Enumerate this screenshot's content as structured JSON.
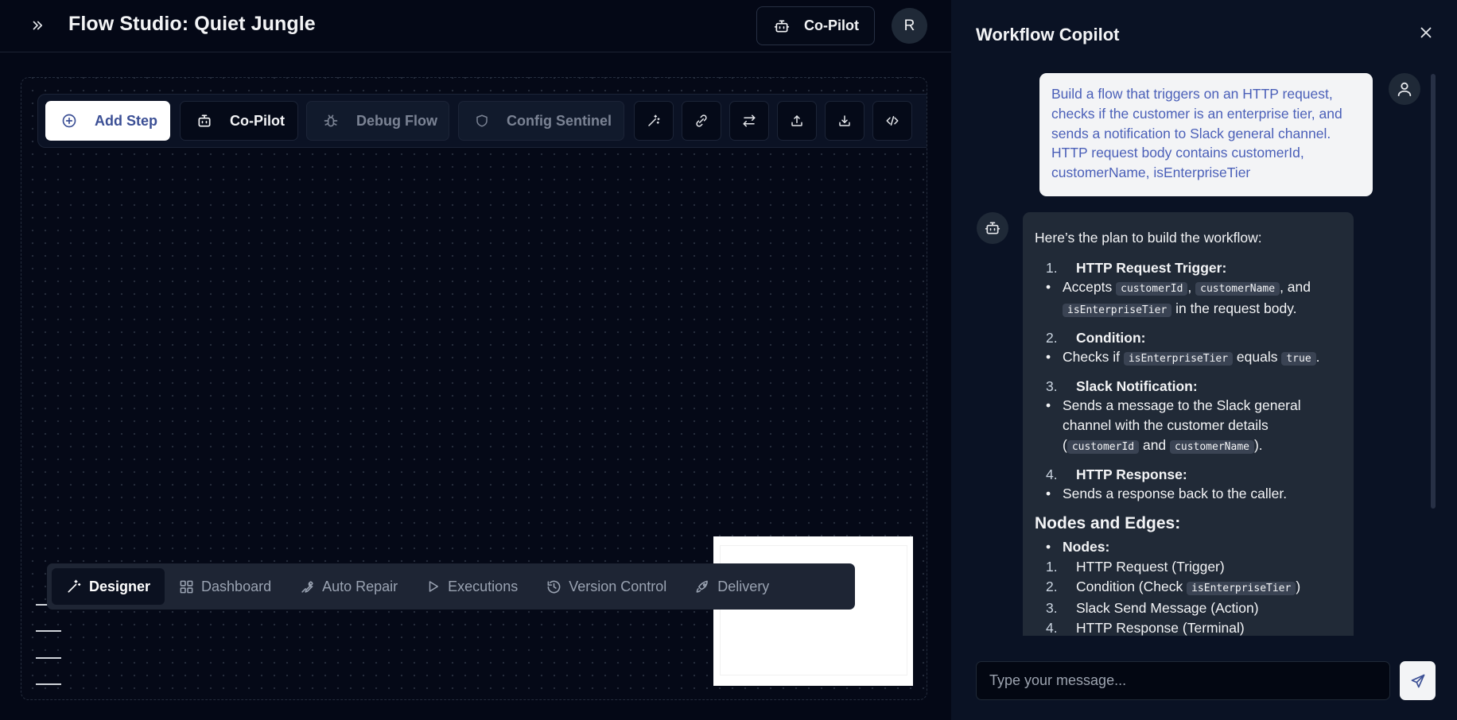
{
  "app": {
    "title": "Flow Studio: Quiet Jungle",
    "copilot_button": "Co-Pilot",
    "avatar_initial": "R"
  },
  "toolbar": {
    "add_step": "Add Step",
    "copilot": "Co-Pilot",
    "debug_flow": "Debug Flow",
    "config_sentinel": "Config Sentinel",
    "icon_buttons": [
      "magic-wand-icon",
      "link-icon",
      "swap-icon",
      "upload-icon",
      "download-icon",
      "code-icon"
    ]
  },
  "bottom_nav": {
    "items": [
      {
        "label": "Designer",
        "icon": "magic-wand-icon",
        "active": true
      },
      {
        "label": "Dashboard",
        "icon": "dashboard-icon",
        "active": false
      },
      {
        "label": "Auto Repair",
        "icon": "wrench-icon",
        "active": false
      },
      {
        "label": "Executions",
        "icon": "play-icon",
        "active": false
      },
      {
        "label": "Version Control",
        "icon": "history-icon",
        "active": false
      },
      {
        "label": "Delivery",
        "icon": "rocket-icon",
        "active": false
      }
    ]
  },
  "copilot_panel": {
    "title": "Workflow Copilot",
    "user_message": "Build a flow that triggers on an HTTP request, checks if the customer is an enterprise tier, and sends a notification to Slack general channel. HTTP request body contains customerId, customerName, isEnterpriseTier",
    "bot": {
      "intro": "Here’s the plan to build the workflow:",
      "steps": [
        {
          "num": "1.",
          "title": "HTTP Request Trigger",
          "colon": ":"
        },
        {
          "num": "2.",
          "title": "Condition",
          "colon": ":"
        },
        {
          "num": "3.",
          "title": "Slack Notification",
          "colon": ":"
        },
        {
          "num": "4.",
          "title": "HTTP Response",
          "colon": ":"
        }
      ],
      "step1_bullet": {
        "a": "Accepts ",
        "code1": "customerId",
        "b": ", ",
        "code2": "customerName",
        "c": ", and ",
        "code3": "isEnterpriseTier",
        "d": " in the request body."
      },
      "step2_bullet": {
        "a": "Checks if ",
        "code1": "isEnterpriseTier",
        "b": " equals ",
        "code2": "true",
        "c": "."
      },
      "step3_bullet": {
        "a": "Sends a message to the Slack general channel with the customer details (",
        "code1": "customerId",
        "b": " and ",
        "code2": "customerName",
        "c": ")."
      },
      "step4_bullet": "Sends a response back to the caller.",
      "nodes_heading": "Nodes and Edges:",
      "nodes_label": "Nodes",
      "nodes_colon": ":",
      "nodes": [
        {
          "num": "1.",
          "text": "HTTP Request (Trigger)"
        },
        {
          "num": "2.",
          "text_a": "Condition (Check ",
          "code": "isEnterpriseTier",
          "text_b": ")"
        },
        {
          "num": "3.",
          "text": "Slack Send Message (Action)"
        },
        {
          "num": "4.",
          "text": "HTTP Response (Terminal)"
        }
      ]
    },
    "input_placeholder": "Type your message..."
  }
}
